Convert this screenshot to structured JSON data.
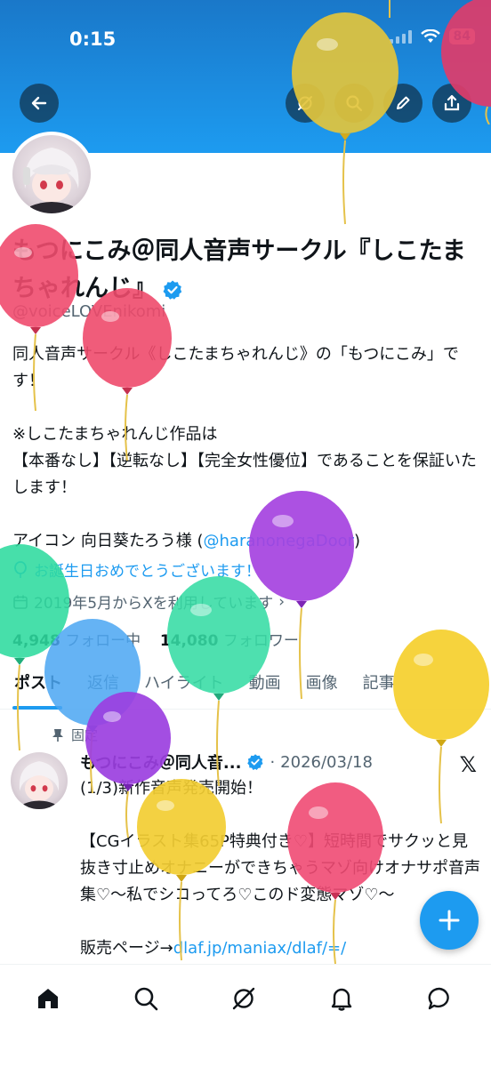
{
  "status_bar": {
    "time": "0:15",
    "battery": "84"
  },
  "profile": {
    "display_name": "もつにこみ＠同人音声サークル『しこたまちゃれんじ』",
    "handle": "@voiceLOVEnikomi",
    "bio_line1": "同人音声サークル《しこたまちゃれんじ》の「もつにこみ」です！",
    "bio_line2": "※しこたまちゃれんじ作品は",
    "bio_line3": "【本番なし】【逆転なし】【完全女性優位】であることを保証いたします！",
    "bio_icon_credit": "アイコン 向日葵たろう様 (",
    "bio_icon_link": "@haranonegaDoor",
    "bio_icon_close": ")",
    "birthday_text": "お誕生日おめでとうございます！",
    "joined_text": "2019年5月からXを利用しています",
    "following_count": "4,948",
    "following_label": "フォロー中",
    "followers_count": "14,080",
    "followers_label": "フォロワー"
  },
  "tabs": [
    "ポスト",
    "返信",
    "ハイライト",
    "動画",
    "画像",
    "記事"
  ],
  "pinned_post": {
    "pinned_label": "固定",
    "author": "もつにこみ＠同人音...",
    "date": "2026/03/18",
    "line1": "(1/3)新作音声発売開始！",
    "line2": "【CGイラスト集65P特典付き♡】短時間でサクッと見抜き寸止めオナニーができちゃうマゾ向けオナサポ音声集♡〜私でシコってろ♡このド変態マゾ♡〜",
    "line3_prefix": "販売ページ→",
    "line3_link": "dlaf.jp/maniax/dlaf/=/"
  },
  "colors": {
    "accent": "#1d9bf0",
    "text": "#0f1419",
    "muted": "#536471"
  },
  "icons": [
    "back-arrow-icon",
    "grok-icon",
    "search-icon",
    "edit-icon",
    "share-icon",
    "verified-badge-icon",
    "pin-icon",
    "location-icon",
    "calendar-icon",
    "balloon-icon",
    "x-logo-icon",
    "plus-icon",
    "home-icon",
    "explore-icon",
    "grok-nav-icon",
    "notifications-icon",
    "messages-icon"
  ]
}
